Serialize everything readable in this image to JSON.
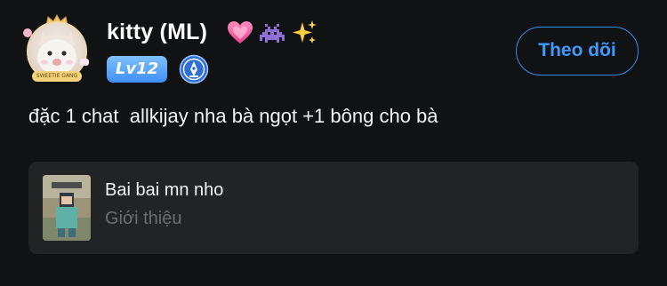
{
  "post": {
    "author": {
      "name": "kitty (ML)",
      "level": "Lv12",
      "emojis": [
        "pink-heart-icon",
        "space-invader-icon",
        "sparkles-icon"
      ],
      "avatar_frame_tag": "SWEETIE GANG"
    },
    "follow_label": "Theo dõi",
    "text": "đặc 1 chat  allkijay nha bà ngọt +1 bông cho bà",
    "attachment": {
      "title": "Bai bai mn nho",
      "subtitle": "Giới thiệu"
    }
  },
  "colors": {
    "background": "#111214",
    "accent": "#2f8cf0",
    "card": "#222325",
    "level_badge": "#4a97f5",
    "muted_text": "#6c6d70"
  }
}
